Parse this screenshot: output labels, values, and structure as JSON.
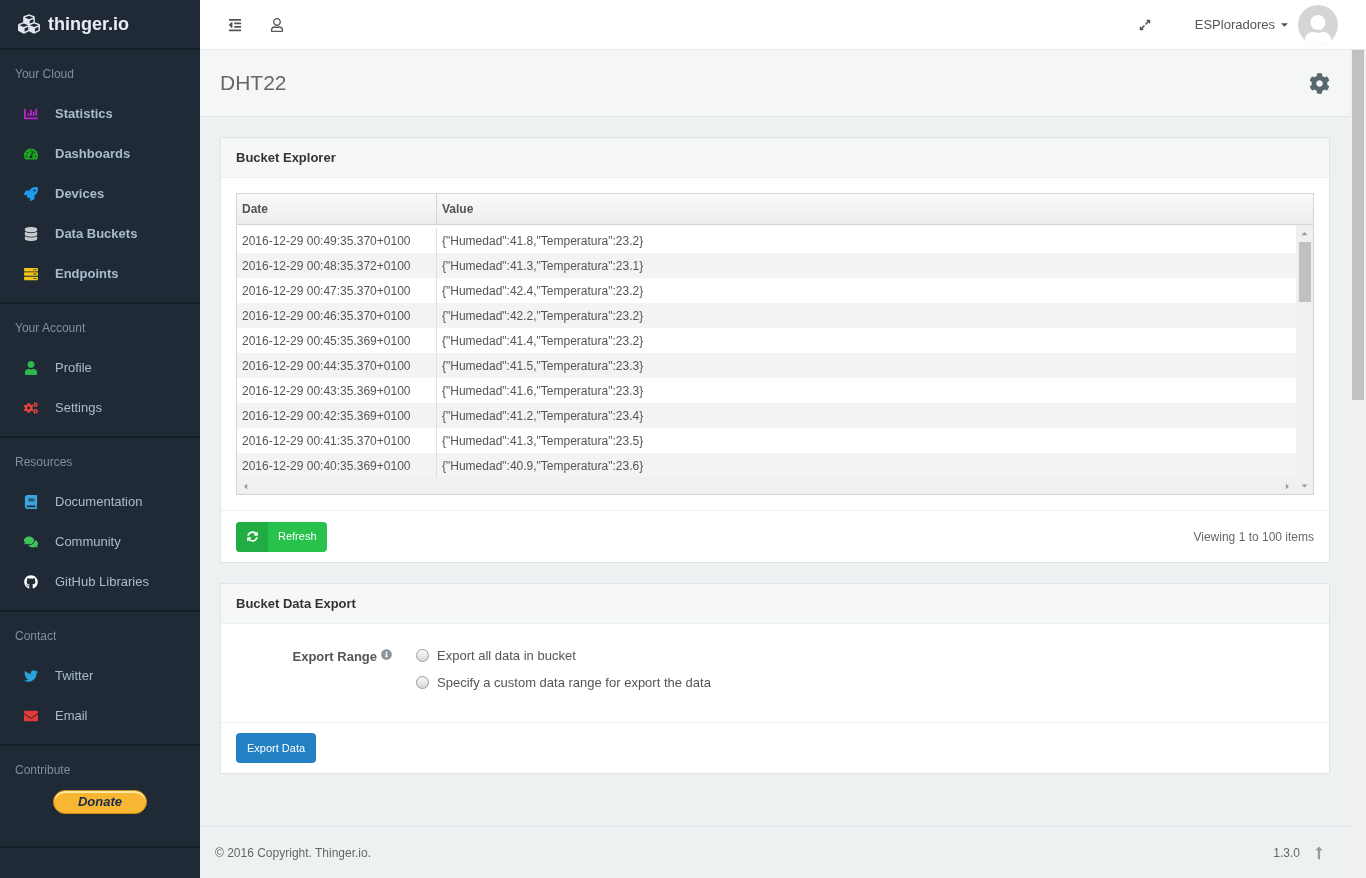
{
  "brand": "thinger.io",
  "sidebar": [
    {
      "heading": "Your Cloud",
      "kind": "primary",
      "items": [
        {
          "label": "Statistics",
          "color": "#c21fd8"
        },
        {
          "label": "Dashboards",
          "color": "#1aa81a"
        },
        {
          "label": "Devices",
          "color": "#1e9be8"
        },
        {
          "label": "Data Buckets",
          "color": "#c8ccd0"
        },
        {
          "label": "Endpoints",
          "color": "#f2c31a"
        }
      ]
    },
    {
      "heading": "Your Account",
      "kind": "secondary",
      "items": [
        {
          "label": "Profile",
          "color": "#2db84d"
        },
        {
          "label": "Settings",
          "color": "#e8413b"
        }
      ]
    },
    {
      "heading": "Resources",
      "kind": "secondary",
      "items": [
        {
          "label": "Documentation",
          "color": "#3aa6e0"
        },
        {
          "label": "Community",
          "color": "#3ec45a"
        },
        {
          "label": "GitHub Libraries",
          "color": "#ffffff"
        }
      ]
    },
    {
      "heading": "Contact",
      "kind": "secondary",
      "items": [
        {
          "label": "Twitter",
          "color": "#2aa3db"
        },
        {
          "label": "Email",
          "color": "#e63a3a"
        }
      ]
    },
    {
      "heading": "Contribute",
      "kind": "donate",
      "items": [
        {
          "label": "Donate",
          "color": "#f7b733"
        }
      ]
    }
  ],
  "topbar": {
    "user": "ESPloradores"
  },
  "page_title": "DHT22",
  "explorer": {
    "title": "Bucket Explorer",
    "columns": [
      "Date",
      "Value"
    ],
    "rows": [
      [
        "2016-12-29 00:49:35.370+0100",
        "{\"Humedad\":41.8,\"Temperatura\":23.2}"
      ],
      [
        "2016-12-29 00:48:35.372+0100",
        "{\"Humedad\":41.3,\"Temperatura\":23.1}"
      ],
      [
        "2016-12-29 00:47:35.370+0100",
        "{\"Humedad\":42.4,\"Temperatura\":23.2}"
      ],
      [
        "2016-12-29 00:46:35.370+0100",
        "{\"Humedad\":42.2,\"Temperatura\":23.2}"
      ],
      [
        "2016-12-29 00:45:35.369+0100",
        "{\"Humedad\":41.4,\"Temperatura\":23.2}"
      ],
      [
        "2016-12-29 00:44:35.370+0100",
        "{\"Humedad\":41.5,\"Temperatura\":23.3}"
      ],
      [
        "2016-12-29 00:43:35.369+0100",
        "{\"Humedad\":41.6,\"Temperatura\":23.3}"
      ],
      [
        "2016-12-29 00:42:35.369+0100",
        "{\"Humedad\":41.2,\"Temperatura\":23.4}"
      ],
      [
        "2016-12-29 00:41:35.370+0100",
        "{\"Humedad\":41.3,\"Temperatura\":23.5}"
      ],
      [
        "2016-12-29 00:40:35.369+0100",
        "{\"Humedad\":40.9,\"Temperatura\":23.6}"
      ]
    ],
    "refresh_button": "Refresh",
    "status": "Viewing 1 to 100 items"
  },
  "export": {
    "title": "Bucket Data Export",
    "label": "Export Range",
    "options": [
      {
        "label": "Export all data in bucket",
        "selected": false
      },
      {
        "label": "Specify a custom data range for export the data",
        "selected": false
      }
    ],
    "button": "Export Data"
  },
  "footer": {
    "copyright": "© 2016 Copyright. Thinger.io.",
    "version": "1.3.0"
  }
}
